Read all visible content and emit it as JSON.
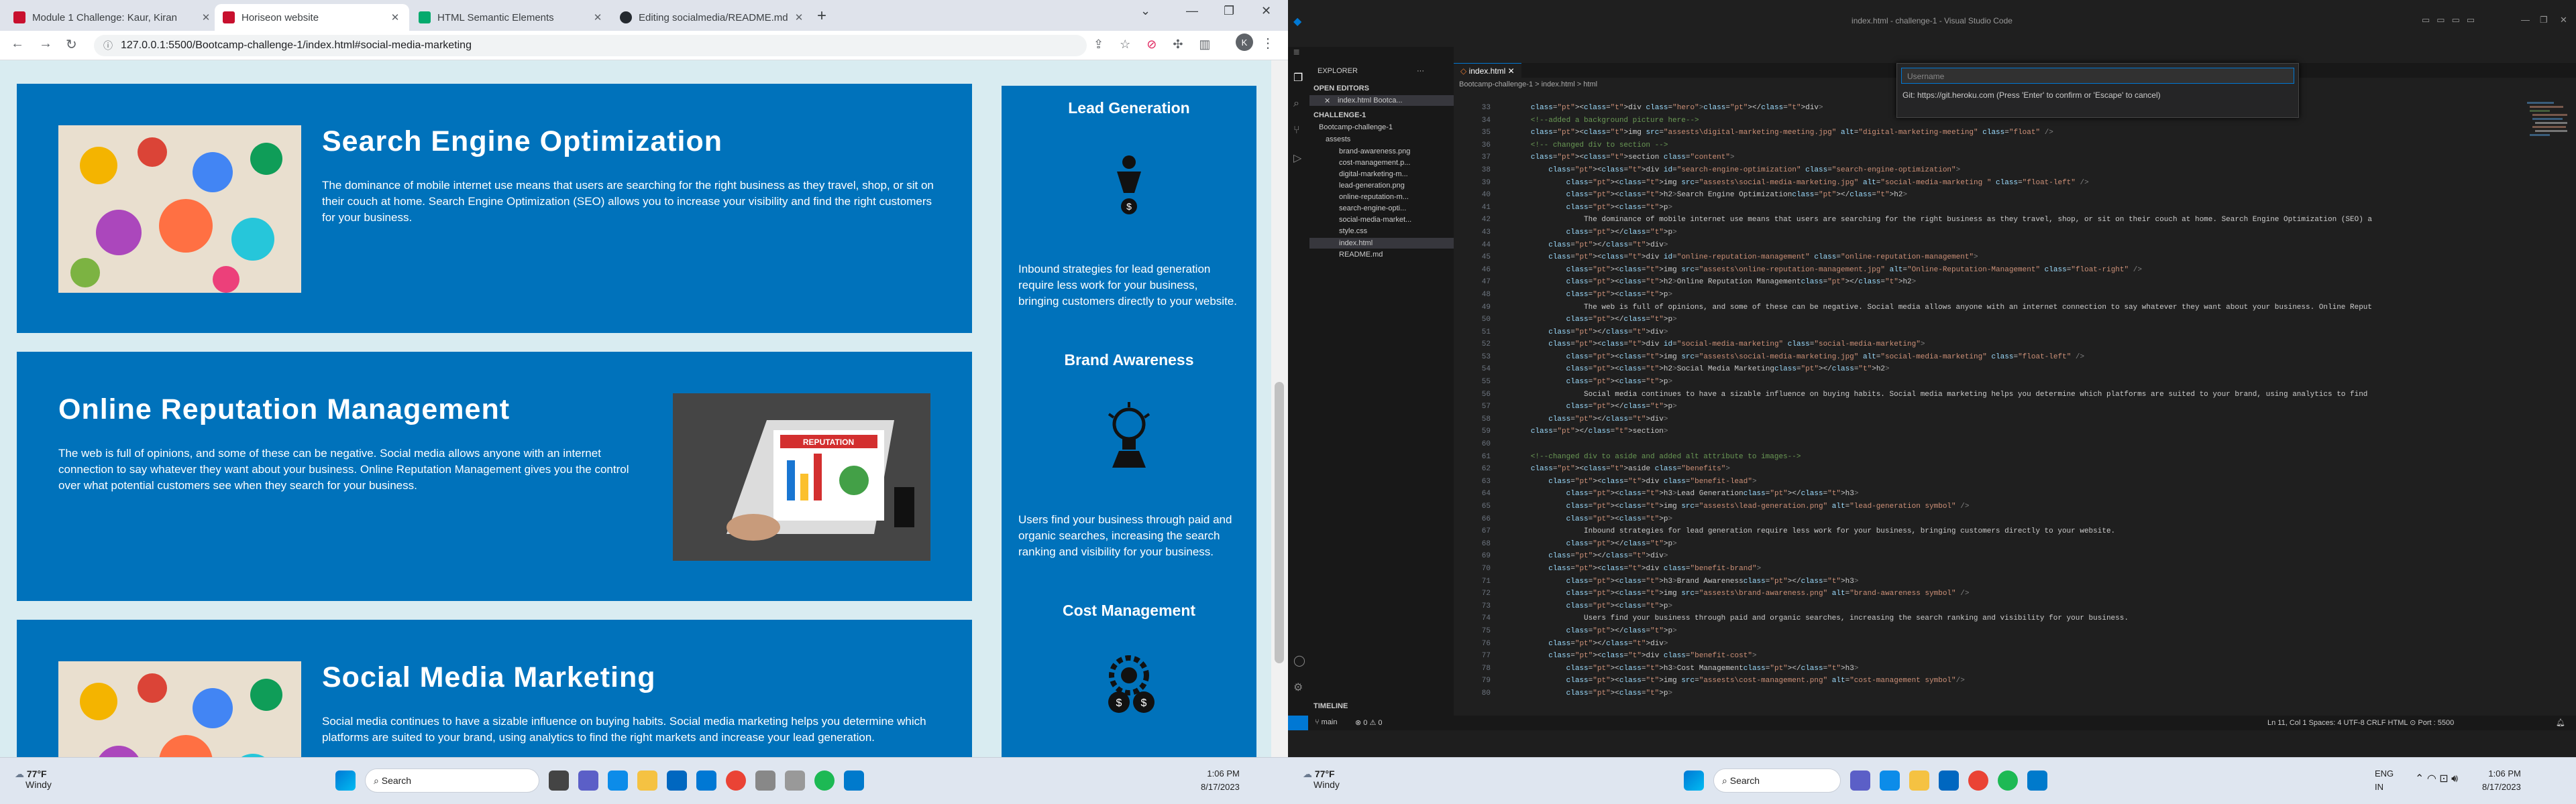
{
  "browser": {
    "tabs": [
      {
        "title": "Module 1 Challenge: Kaur, Kiran"
      },
      {
        "title": "Horiseon website"
      },
      {
        "title": "HTML Semantic Elements"
      },
      {
        "title": "Editing socialmedia/README.md"
      }
    ],
    "url": "127.0.0.1:5500/Bootcamp-challenge-1/index.html#social-media-marketing",
    "avatar_letter": "K"
  },
  "site": {
    "sections": [
      {
        "title": "Search Engine Optimization",
        "text": "The dominance of mobile internet use means that users are searching for the right business as they travel, shop, or sit on their couch at home. Search Engine Optimization (SEO) allows you to increase your visibility and find the right customers for your business."
      },
      {
        "title": "Online Reputation Management",
        "text": "The web is full of opinions, and some of these can be negative. Social media allows anyone with an internet connection to say whatever they want about your business. Online Reputation Management gives you the control over what potential customers see when they search for your business."
      },
      {
        "title": "Social Media Marketing",
        "text": "Social media continues to have a sizable influence on buying habits. Social media marketing helps you determine which platforms are suited to your brand, using analytics to find the right markets and increase your lead generation."
      }
    ],
    "reputation_sign": "REPUTATION",
    "benefits": [
      {
        "title": "Lead Generation",
        "text": "Inbound strategies for lead generation require less work for your business, bringing customers directly to your website."
      },
      {
        "title": "Brand Awareness",
        "text": "Users find your business through paid and organic searches, increasing the search ranking and visibility for your business."
      },
      {
        "title": "Cost Management",
        "text": ""
      }
    ]
  },
  "vscode": {
    "window_title": "index.html - challenge-1 - Visual Studio Code",
    "quick_input_placeholder": "Username",
    "quick_input_hint": "Git: https://git.heroku.com (Press 'Enter' to confirm or 'Escape' to cancel)",
    "explorer_title": "EXPLORER",
    "open_editors_label": "OPEN EDITORS",
    "open_editor_file": "index.html Bootca...",
    "workspace_label": "CHALLENGE-1",
    "folder": "Bootcamp-challenge-1",
    "subfolder": "assests",
    "files": [
      "brand-awareness.png",
      "cost-management.p...",
      "digital-marketing-m...",
      "lead-generation.png",
      "online-reputation-m...",
      "search-engine-opti...",
      "social-media-market...",
      "style.css",
      "index.html",
      "README.md"
    ],
    "timeline_label": "TIMELINE",
    "editor_tab": "index.html",
    "breadcrumb": "Bootcamp-challenge-1  >  index.html  >  html",
    "line_start": 33,
    "code": [
      "        <div class=\"hero\"></div>",
      "        <!--added a background picture here-->",
      "        <img src=\"assests\\digital-marketing-meeting.jpg\" alt=\"digital-marketing-meeting\" class=\"float\" />",
      "        <!-- changed div to section -->",
      "        <section class=\"content\">",
      "            <div id=\"search-engine-optimization\" class=\"search-engine-optimization\">",
      "                <img src=\"assests\\social-media-marketing.jpg\" alt=\"social-media-marketing \" class=\"float-left\" />",
      "                <h2>Search Engine Optimization</h2>",
      "                <p>",
      "                    The dominance of mobile internet use means that users are searching for the right business as they travel, shop, or sit on their couch at home. Search Engine Optimization (SEO) a",
      "                </p>",
      "            </div>",
      "            <div id=\"online-reputation-management\" class=\"online-reputation-management\">",
      "                <img src=\"assests\\online-reputation-management.jpg\" alt=\"Online-Reputation-Management\" class=\"float-right\" />",
      "                <h2>Online Reputation Management</h2>",
      "                <p>",
      "                    The web is full of opinions, and some of these can be negative. Social media allows anyone with an internet connection to say whatever they want about your business. Online Reput",
      "                </p>",
      "            </div>",
      "            <div id=\"social-media-marketing\" class=\"social-media-marketing\">",
      "                <img src=\"assests\\social-media-marketing.jpg\" alt=\"social-media-marketing\" class=\"float-left\" />",
      "                <h2>Social Media Marketing</h2>",
      "                <p>",
      "                    Social media continues to have a sizable influence on buying habits. Social media marketing helps you determine which platforms are suited to your brand, using analytics to find",
      "                </p>",
      "            </div>",
      "        </section>",
      "",
      "        <!--changed div to aside and added alt attribute to images-->",
      "        <aside class=\"benefits\">",
      "            <div class=\"benefit-lead\">",
      "                <h3>Lead Generation</h3>",
      "                <img src=\"assests\\lead-generation.png\" alt=\"lead-generation symbol\" />",
      "                <p>",
      "                    Inbound strategies for lead generation require less work for your business, bringing customers directly to your website.",
      "                </p>",
      "            </div>",
      "            <div class=\"benefit-brand\">",
      "                <h3>Brand Awareness</h3>",
      "                <img src=\"assests\\brand-awareness.png\" alt=\"brand-awareness symbol\" />",
      "                <p>",
      "                    Users find your business through paid and organic searches, increasing the search ranking and visibility for your business.",
      "                </p>",
      "            </div>",
      "            <div class=\"benefit-cost\">",
      "                <h3>Cost Management</h3>",
      "                <img src=\"assests\\cost-management.png\" alt=\"cost-management symbol\"/>",
      "                <p>"
    ],
    "status_branch": "main",
    "status_problems": "⊗ 0 ⚠ 0",
    "status_right": "Ln 11, Col 1   Spaces: 4   UTF-8   CRLF   HTML   ⊙ Port : 5500"
  },
  "taskbar_left": {
    "temp": "77°F",
    "cond": "Windy",
    "search": "Search",
    "time": "1:06 PM",
    "date": "8/17/2023"
  },
  "taskbar_right": {
    "temp": "77°F",
    "cond": "Windy",
    "search": "Search",
    "lang1": "ENG",
    "lang2": "IN",
    "time": "1:06 PM",
    "date": "8/17/2023"
  },
  "colors": {
    "site_blue": "#0072bb",
    "site_bg": "#d9ecf1",
    "vscode_bg": "#1f1f1f"
  }
}
